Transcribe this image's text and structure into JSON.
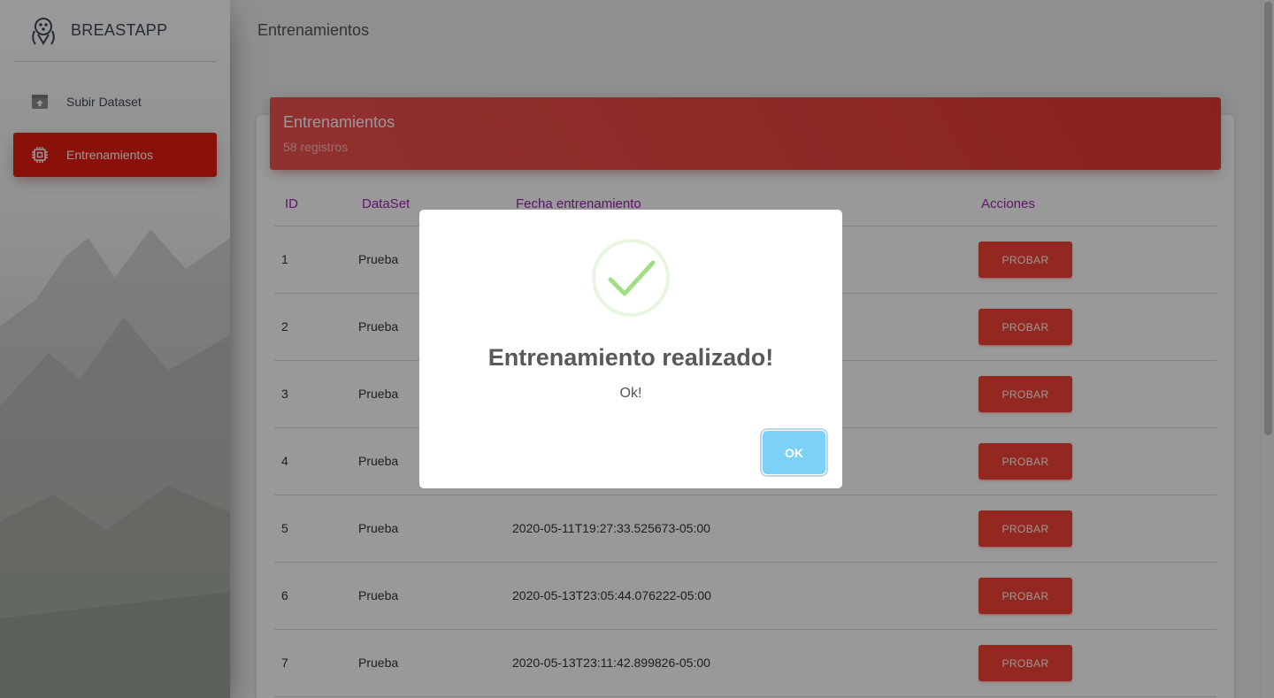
{
  "brand": {
    "name": "BREASTAPP",
    "logo_icon": "ribbon-logo-icon"
  },
  "sidebar": {
    "items": [
      {
        "label": "Subir Dataset",
        "icon": "upload-box-icon",
        "active": false
      },
      {
        "label": "Entrenamientos",
        "icon": "chip-icon",
        "active": true
      }
    ]
  },
  "page": {
    "title": "Entrenamientos"
  },
  "card": {
    "title": "Entrenamientos",
    "subtitle": "58 registros",
    "columns": [
      "ID",
      "DataSet",
      "Fecha entrenamiento",
      "Acciones"
    ],
    "rows": [
      {
        "id": "1",
        "dataset": "Prueba",
        "fecha": "",
        "action": "PROBAR"
      },
      {
        "id": "2",
        "dataset": "Prueba",
        "fecha": "",
        "action": "PROBAR"
      },
      {
        "id": "3",
        "dataset": "Prueba",
        "fecha": "",
        "action": "PROBAR"
      },
      {
        "id": "4",
        "dataset": "Prueba",
        "fecha": "",
        "action": "PROBAR"
      },
      {
        "id": "5",
        "dataset": "Prueba",
        "fecha": "2020-05-11T19:27:33.525673-05:00",
        "action": "PROBAR"
      },
      {
        "id": "6",
        "dataset": "Prueba",
        "fecha": "2020-05-13T23:05:44.076222-05:00",
        "action": "PROBAR"
      },
      {
        "id": "7",
        "dataset": "Prueba",
        "fecha": "2020-05-13T23:11:42.899826-05:00",
        "action": "PROBAR"
      }
    ]
  },
  "modal": {
    "icon": "success-check-icon",
    "title": "Entrenamiento realizado!",
    "text": "Ok!",
    "confirm_label": "OK"
  },
  "colors": {
    "accent": "#f44336",
    "header_text": "#9c27b0",
    "ok_button": "#7cd1f9",
    "success": "#a5dc86"
  }
}
